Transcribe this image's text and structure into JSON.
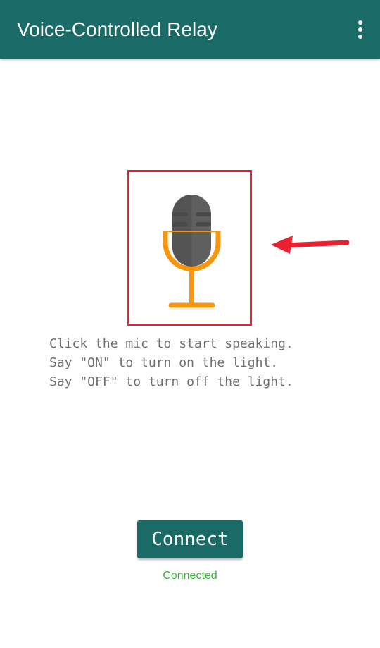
{
  "app_bar": {
    "title": "Voice-Controlled Relay",
    "background": "#1a6b67",
    "menu_icon": "more-vert-icon"
  },
  "mic": {
    "icon": "microphone-icon",
    "highlight_color": "#e8202f",
    "stand_color": "#f7960f",
    "body_color": "#5f5f5f",
    "pointer_icon": "left-arrow-icon"
  },
  "instructions": [
    "Click the mic to start speaking.",
    "Say \"ON\" to turn on the light.",
    "Say \"OFF\" to turn off the light."
  ],
  "connect_button": {
    "label": "Connect"
  },
  "status": {
    "text": "Connected",
    "color": "#3db53a"
  }
}
